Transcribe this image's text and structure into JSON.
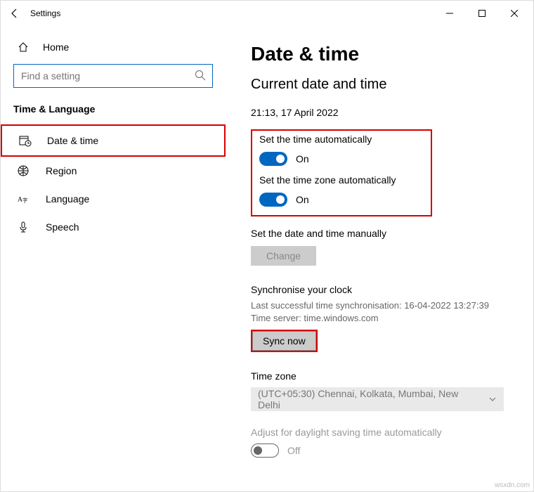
{
  "window": {
    "title": "Settings"
  },
  "sidebar": {
    "home": "Home",
    "search_placeholder": "Find a setting",
    "section": "Time & Language",
    "items": [
      {
        "label": "Date & time"
      },
      {
        "label": "Region"
      },
      {
        "label": "Language"
      },
      {
        "label": "Speech"
      }
    ]
  },
  "content": {
    "title": "Date & time",
    "subtitle": "Current date and time",
    "current": "21:13, 17 April 2022",
    "auto_time": {
      "label": "Set the time automatically",
      "state": "On"
    },
    "auto_tz": {
      "label": "Set the time zone automatically",
      "state": "On"
    },
    "manual": {
      "label": "Set the date and time manually",
      "button": "Change"
    },
    "sync": {
      "title": "Synchronise your clock",
      "last": "Last successful time synchronisation: 16-04-2022 13:27:39",
      "server": "Time server: time.windows.com",
      "button": "Sync now"
    },
    "tz": {
      "label": "Time zone",
      "value": "(UTC+05:30) Chennai, Kolkata, Mumbai, New Delhi"
    },
    "dst": {
      "label": "Adjust for daylight saving time automatically",
      "state": "Off"
    }
  },
  "watermark": "wsxdn.com"
}
